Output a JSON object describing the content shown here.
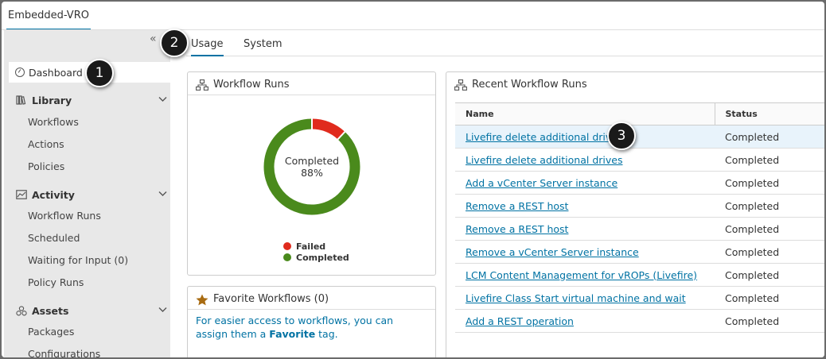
{
  "app_tab": "Embedded-VRO",
  "collapse_glyph": "«",
  "sidebar": {
    "dashboard": "Dashboard",
    "sections": [
      {
        "label": "Library",
        "icon": "library-icon",
        "items": [
          "Workflows",
          "Actions",
          "Policies"
        ]
      },
      {
        "label": "Activity",
        "icon": "activity-icon",
        "items": [
          "Workflow Runs",
          "Scheduled",
          "Waiting for Input (0)",
          "Policy Runs"
        ]
      },
      {
        "label": "Assets",
        "icon": "assets-icon",
        "items": [
          "Packages",
          "Configurations"
        ]
      }
    ]
  },
  "tabs": [
    {
      "label": "Usage",
      "active": true
    },
    {
      "label": "System",
      "active": false
    }
  ],
  "workflow_runs": {
    "title": "Workflow Runs",
    "center_label": "Completed",
    "center_value": "88%",
    "chart_data": {
      "type": "pie",
      "categories": [
        "Failed",
        "Completed"
      ],
      "values": [
        12,
        88
      ],
      "colors": [
        "#e02b1d",
        "#4a8a1c"
      ]
    },
    "legend": [
      {
        "label": "Failed",
        "color": "#e02b1d"
      },
      {
        "label": "Completed",
        "color": "#4a8a1c"
      }
    ]
  },
  "favorites": {
    "title": "Favorite Workflows (0)",
    "text_before": "For easier access to workflows, you can assign them a ",
    "text_bold": "Favorite",
    "text_after": " tag."
  },
  "recent": {
    "title": "Recent Workflow Runs",
    "columns": [
      "Name",
      "Status"
    ],
    "rows": [
      {
        "name": "Livefire delete additional drives",
        "status": "Completed"
      },
      {
        "name": "Livefire delete additional drives",
        "status": "Completed"
      },
      {
        "name": "Add a vCenter Server instance",
        "status": "Completed"
      },
      {
        "name": "Remove a REST host",
        "status": "Completed"
      },
      {
        "name": "Remove a REST host",
        "status": "Completed"
      },
      {
        "name": "Remove a vCenter Server instance",
        "status": "Completed"
      },
      {
        "name": "LCM Content Management for vROPs (Livefire)",
        "status": "Completed"
      },
      {
        "name": "Livefire Class Start virtual machine and wait",
        "status": "Completed"
      },
      {
        "name": "Add a REST operation",
        "status": "Completed"
      }
    ]
  },
  "callouts": [
    "1",
    "2",
    "3"
  ]
}
